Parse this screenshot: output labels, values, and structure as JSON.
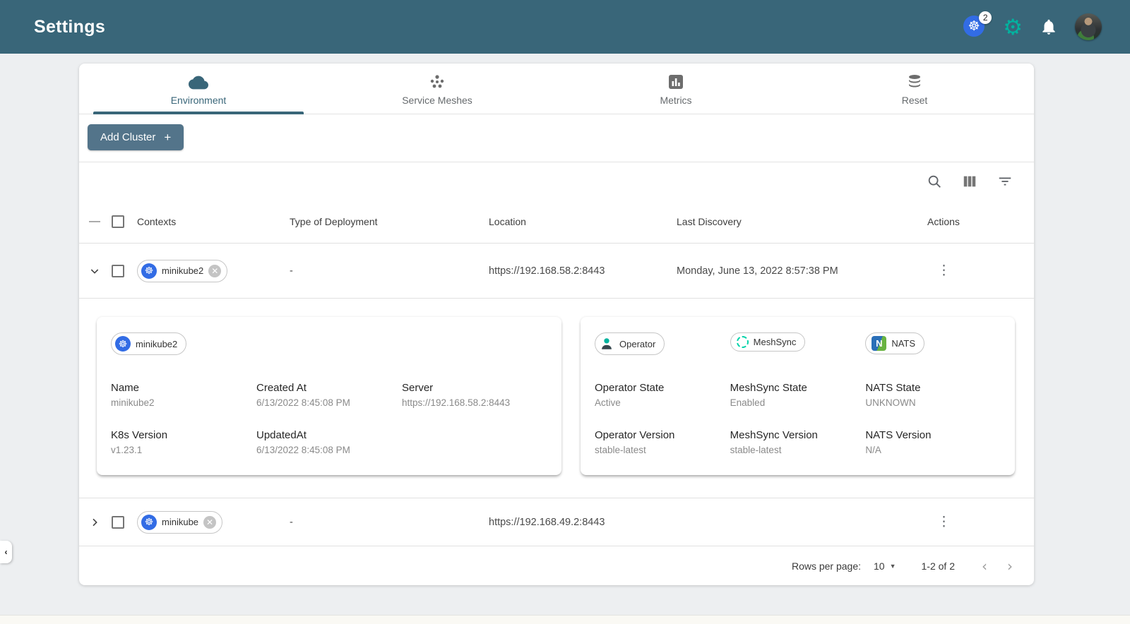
{
  "colors": {
    "accent": "#396679",
    "brand_green": "#00B39F",
    "k8s_blue": "#326CE5"
  },
  "header": {
    "title": "Settings",
    "kubernetes_context_badge": "2",
    "icons": [
      "kubernetes-icon",
      "gear-icon",
      "bell-icon",
      "user-avatar"
    ]
  },
  "tabs": [
    {
      "label": "Environment",
      "icon": "cloud-icon",
      "active": true
    },
    {
      "label": "Service Meshes",
      "icon": "mesh-icon",
      "active": false
    },
    {
      "label": "Metrics",
      "icon": "bar-chart-icon",
      "active": false
    },
    {
      "label": "Reset",
      "icon": "database-icon",
      "active": false
    }
  ],
  "actions_bar": {
    "add_cluster_label": "Add Cluster",
    "add_cluster_plus": "+"
  },
  "table_toolbar": {
    "icons": [
      "search-icon",
      "view-columns-icon",
      "filter-icon"
    ]
  },
  "table": {
    "columns": [
      "Contexts",
      "Type of Deployment",
      "Location",
      "Last Discovery",
      "Actions"
    ],
    "rows": [
      {
        "context": "minikube2",
        "type_of_deployment": "-",
        "location": "https://192.168.58.2:8443",
        "last_discovery": "Monday, June 13, 2022 8:57:38 PM",
        "expanded": true
      },
      {
        "context": "minikube",
        "type_of_deployment": "-",
        "location": "https://192.168.49.2:8443",
        "last_discovery": "",
        "expanded": false
      }
    ]
  },
  "details": {
    "cluster_chip": "minikube2",
    "fields": [
      {
        "label": "Name",
        "value": "minikube2"
      },
      {
        "label": "Created At",
        "value": "6/13/2022 8:45:08 PM"
      },
      {
        "label": "Server",
        "value": "https://192.168.58.2:8443"
      },
      {
        "label": "K8s Version",
        "value": "v1.23.1"
      },
      {
        "label": "UpdatedAt",
        "value": "6/13/2022 8:45:08 PM"
      }
    ],
    "components": {
      "chips": [
        "Operator",
        "MeshSync",
        "NATS"
      ],
      "fields": [
        {
          "label": "Operator State",
          "value": "Active"
        },
        {
          "label": "MeshSync State",
          "value": "Enabled"
        },
        {
          "label": "NATS State",
          "value": "UNKNOWN"
        },
        {
          "label": "Operator Version",
          "value": "stable-latest"
        },
        {
          "label": "MeshSync Version",
          "value": "stable-latest"
        },
        {
          "label": "NATS Version",
          "value": "N/A"
        }
      ]
    }
  },
  "pagination": {
    "rows_per_page_label": "Rows per page:",
    "rows_per_page_value": "10",
    "range_label": "1-2 of 2"
  }
}
